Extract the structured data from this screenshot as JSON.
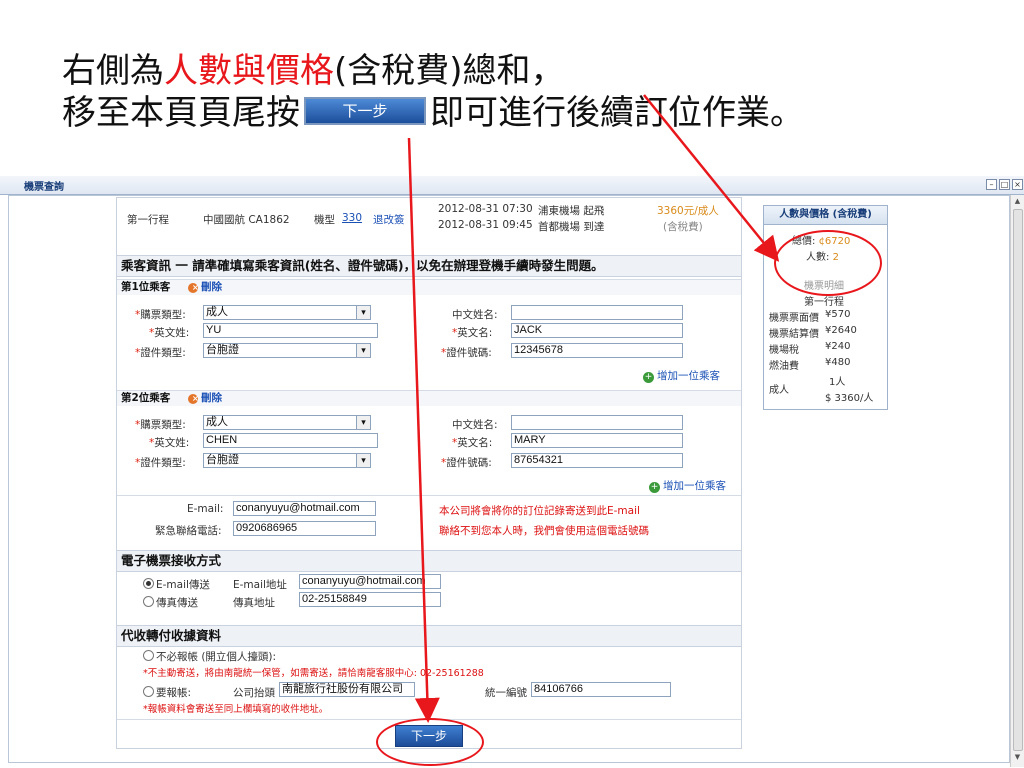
{
  "slide": {
    "line1_a": "右側為",
    "line1_red": "人數與價格",
    "line1_b": "(含稅費)總和，",
    "line2_a": "移至本頁頁尾按",
    "line2_btn": "下一步",
    "line2_b": "即可進行後續訂位作業。"
  },
  "window": {
    "title": "機票查詢"
  },
  "flight": {
    "segment": "第一行程",
    "airline": "中國國航 CA1862",
    "model_label": "機型",
    "model": "330",
    "refund_link": "退改簽",
    "dep_time": "2012-08-31 07:30",
    "dep_place": "浦東機場 起飛",
    "arr_time": "2012-08-31 09:45",
    "arr_place": "首都機場 到達",
    "price": "3360元/成人",
    "tax_note": "(含稅費)"
  },
  "passenger_info": {
    "header": "乘客資訊 一 請準確填寫乘客資訊(姓名、證件號碼)，以免在辦理登機手續時發生問題。",
    "labels": {
      "ticket_type": "購票類型:",
      "en_surname": "英文姓:",
      "id_type": "證件類型:",
      "cn_name": "中文姓名:",
      "en_given": "英文名:",
      "id_number": "證件號碼:"
    },
    "delete_label": "刪除",
    "add_label": "增加一位乘客",
    "passengers": [
      {
        "title": "第1位乘客",
        "ticket_type": "成人",
        "en_surname": "YU",
        "id_type": "台胞證",
        "cn_name": "",
        "en_given": "JACK",
        "id_number": "12345678"
      },
      {
        "title": "第2位乘客",
        "ticket_type": "成人",
        "en_surname": "CHEN",
        "id_type": "台胞證",
        "cn_name": "",
        "en_given": "MARY",
        "id_number": "87654321"
      }
    ]
  },
  "contact": {
    "email_label": "E-mail:",
    "email": "conanyuyu@hotmail.com",
    "phone_label": "緊急聯絡電話:",
    "phone": "0920686965",
    "email_note": "本公司將會將你的訂位記錄寄送到此E-mail",
    "phone_note": "聯絡不到您本人時，我們會使用這個電話號碼"
  },
  "eticket": {
    "header": "電子機票接收方式",
    "email_option": "E-mail傳送",
    "email_addr_label": "E-mail地址",
    "email_addr": "conanyuyu@hotmail.com",
    "fax_option": "傳真傳送",
    "fax_addr_label": "傳真地址",
    "fax_addr": "02-25158849"
  },
  "receipt": {
    "header": "代收轉付收據資料",
    "no_receipt": "不必報帳 (開立個人擡頭):",
    "no_receipt_note": "*不主動寄送，將由南龍統一保管，如需寄送，請恰南龍客服中心: 02-25161288",
    "need_receipt": "要報帳:",
    "company_label": "公司抬頭",
    "company": "南龍旅行社股份有限公司",
    "tax_id_label": "統一編號",
    "tax_id": "84106766",
    "mail_note": "*報帳資料會寄送至同上欄填寫的收件地址。"
  },
  "next_button": "下一步",
  "sidebar": {
    "header": "人數與價格 (含稅費)",
    "total_label": "總價:",
    "total": "¢6720",
    "count_label": "人數:",
    "count": "2",
    "detail_title": "機票明細",
    "segment": "第一行程",
    "rows": [
      {
        "label": "機票票面價",
        "value": "¥570"
      },
      {
        "label": "機票結算價",
        "value": "¥2640"
      },
      {
        "label": "機場稅",
        "value": "¥240"
      },
      {
        "label": "燃油費",
        "value": "¥480"
      }
    ],
    "adult_label": "成人",
    "adult_count": "1人",
    "adult_price": "$ 3360/人"
  },
  "colors": {
    "highlight": "#e8171c",
    "accent_blue": "#1d4c98",
    "price_orange": "#d98a1a"
  }
}
